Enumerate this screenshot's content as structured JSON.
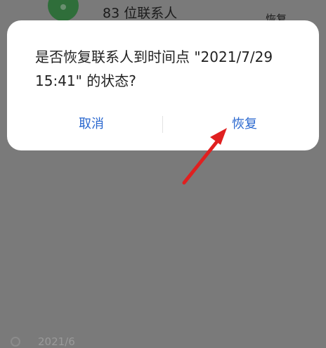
{
  "background": {
    "contact_count_title": "83 位联系人",
    "restore_label": "恢复",
    "date_label": "2021/6"
  },
  "dialog": {
    "message": "是否恢复联系人到时间点 \"2021/7/29 15:41\" 的状态?",
    "cancel_label": "取消",
    "confirm_label": "恢复"
  },
  "colors": {
    "accent": "#2967cf",
    "annotation": "#e02020"
  },
  "icons": {
    "avatar": "contact-avatar-icon",
    "clock": "clock-icon",
    "arrow": "annotation-arrow-icon"
  }
}
